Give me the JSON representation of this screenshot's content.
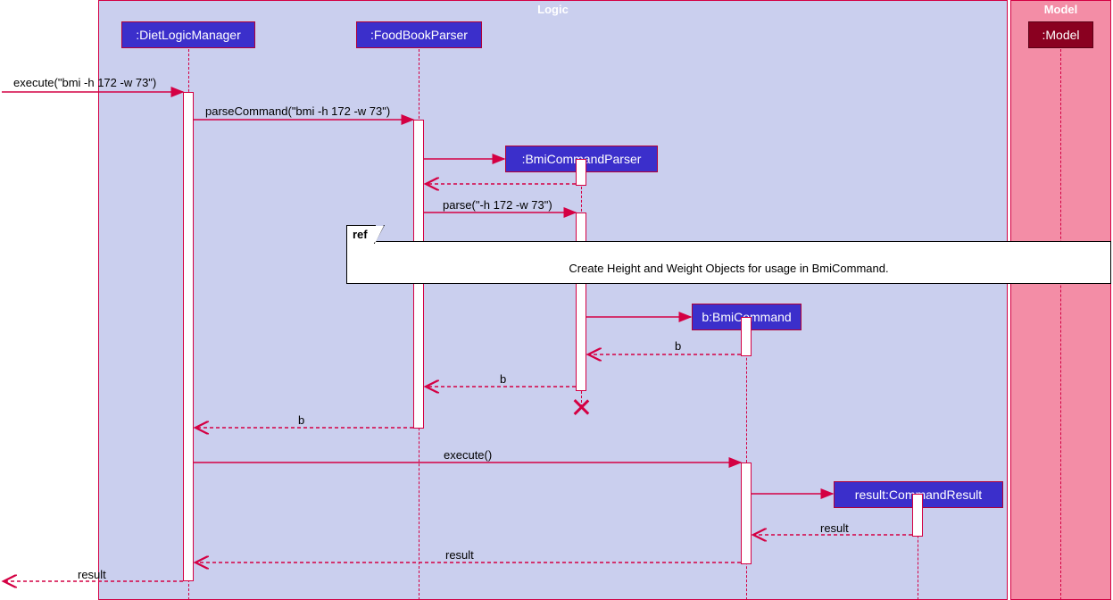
{
  "frames": {
    "logic": "Logic",
    "model": "Model"
  },
  "participants": {
    "dietLogicManager": ":DietLogicManager",
    "foodBookParser": ":FoodBookParser",
    "bmiCommandParser": ":BmiCommandParser",
    "bmiCommand": "b:BmiCommand",
    "commandResult": "result:CommandResult",
    "model": ":Model"
  },
  "messages": {
    "execute_bmi": "execute(\"bmi -h 172 -w 73\")",
    "parseCommand": "parseCommand(\"bmi -h 172 -w 73\")",
    "parse": "parse(\"-h 172 -w 73\")",
    "b1": "b",
    "b2": "b",
    "b3": "b",
    "execute": "execute()",
    "result1": "result",
    "result2": "result",
    "result3": "result"
  },
  "ref": {
    "label": "ref",
    "text": "Create Height and Weight Objects for usage in BmiCommand."
  },
  "colors": {
    "line": "#d40043",
    "partFill": "#3b2fcb",
    "logicBg": "#cacfee",
    "modelBg": "#f38da6",
    "modelPart": "#8a0020"
  }
}
